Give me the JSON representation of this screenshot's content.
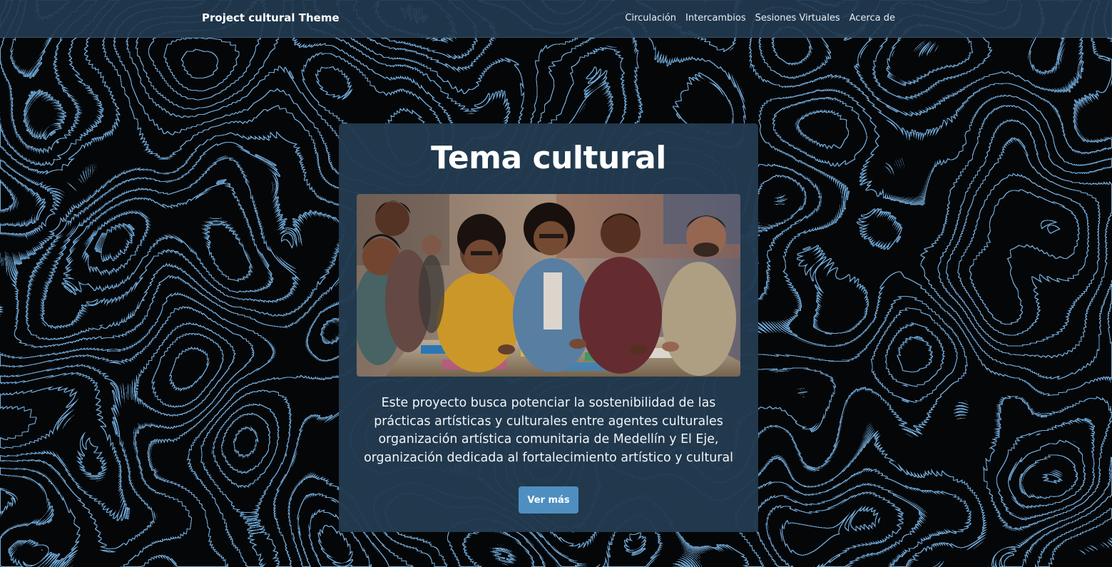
{
  "navbar": {
    "brand": "Project cultural Theme",
    "links": [
      "Circulación",
      "Intercambios",
      "Sesiones Virtuales",
      "Acerca de"
    ]
  },
  "card": {
    "title": "Tema cultural",
    "image_alt": "Personas colaborando en un proyecto artístico",
    "description": "Este proyecto busca potenciar la sostenibilidad de las prácticas artísticas y culturales entre agentes culturales organización artística comunitaria de Medellín y El Eje, organización dedicada al fortalecimiento artístico y cultural",
    "button_label": "Ver más"
  },
  "colors": {
    "navbar_bg": "#223a50",
    "card_bg": "#223a50",
    "button_bg": "#4f8fc0",
    "contour_lines": "#6fa8d6",
    "page_bg": "#050608"
  }
}
